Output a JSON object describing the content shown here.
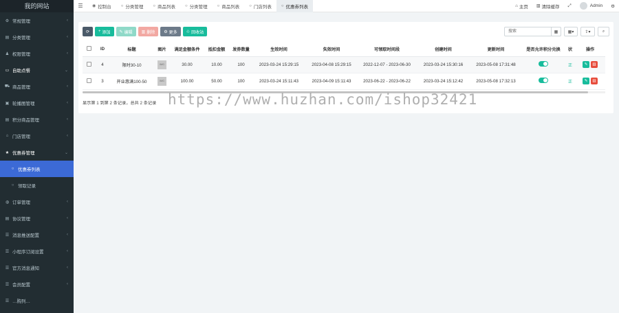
{
  "sidebar": {
    "logo": "我的网站",
    "items": [
      {
        "label": "常规管理",
        "icon": "gear-icon",
        "glyph": "⚙",
        "chevron": "‹"
      },
      {
        "label": "分类管理",
        "icon": "tag-icon",
        "glyph": "▤",
        "chevron": "‹"
      },
      {
        "label": "权限管理",
        "icon": "users-icon",
        "glyph": "♟",
        "chevron": "‹"
      },
      {
        "label": "自助点餐",
        "icon": "card-icon",
        "glyph": "▭",
        "chevron": "⌄"
      },
      {
        "label": "商品管理",
        "icon": "cart-icon",
        "glyph": "⛟",
        "chevron": "‹"
      },
      {
        "label": "轮播图管理",
        "icon": "image-icon",
        "glyph": "▣",
        "chevron": "‹"
      },
      {
        "label": "积分商品管理",
        "icon": "gift-icon",
        "glyph": "▤",
        "chevron": "‹"
      },
      {
        "label": "门店管理",
        "icon": "store-icon",
        "glyph": "⌂",
        "chevron": "‹"
      },
      {
        "label": "优惠券管理",
        "icon": "star-icon",
        "glyph": "★",
        "chevron": "⌄"
      },
      {
        "label": "优惠券列表",
        "icon": "circle-icon",
        "glyph": "○",
        "chevron": ""
      },
      {
        "label": "领取记录",
        "icon": "circle-icon",
        "glyph": "○",
        "chevron": ""
      },
      {
        "label": "订单管理",
        "icon": "globe-icon",
        "glyph": "◍",
        "chevron": "‹"
      },
      {
        "label": "协议管理",
        "icon": "doc-icon",
        "glyph": "▤",
        "chevron": "‹"
      },
      {
        "label": "消息推送配置",
        "icon": "list-icon",
        "glyph": "☰",
        "chevron": "‹"
      },
      {
        "label": "小程序订阅设置",
        "icon": "list-icon",
        "glyph": "☰",
        "chevron": "‹"
      },
      {
        "label": "官方消息通知",
        "icon": "list-icon",
        "glyph": "☰",
        "chevron": "‹"
      },
      {
        "label": "会员配置",
        "icon": "list-icon",
        "glyph": "☰",
        "chevron": "‹"
      },
      {
        "label": "…购列…",
        "icon": "list-icon",
        "glyph": "☰",
        "chevron": ""
      }
    ]
  },
  "topbar": {
    "tabs": [
      {
        "label": "控制台",
        "glyph": "◉"
      },
      {
        "label": "分类管理",
        "glyph": "○"
      },
      {
        "label": "商品列表",
        "glyph": "○"
      },
      {
        "label": "分类管理",
        "glyph": "○"
      },
      {
        "label": "商品列表",
        "glyph": "○"
      },
      {
        "label": "门店列表",
        "glyph": "○"
      },
      {
        "label": "优惠券列表",
        "glyph": "○"
      }
    ],
    "home_label": "主页",
    "clear_cache_label": "清除缓存",
    "user_name": "Admin"
  },
  "toolbar": {
    "add_label": "添加",
    "edit_label": "编辑",
    "delete_label": "删除",
    "more_label": "更多",
    "recycle_label": "回收站",
    "search_placeholder": "搜索"
  },
  "table": {
    "headers": [
      "",
      "ID",
      "标题",
      "图片",
      "满足金额条件",
      "抵扣金额",
      "发券数量",
      "生效时间",
      "失效时间",
      "可领取时间段",
      "创建时间",
      "更新时间",
      "是否允许积分兑换",
      "状",
      "操作"
    ],
    "rows": [
      {
        "id": "4",
        "title": "限时30-10",
        "image_text": "IMG",
        "threshold": "30.00",
        "discount": "10.00",
        "quantity": "100",
        "start_time": "2023-03-24 15:29:15",
        "end_time": "2023-04-08 15:29:15",
        "claim_period": "2022-12-07 - 2023-06-30",
        "created_at": "2023-03-24 15:30:16",
        "updated_at": "2023-05-08 17:31:48",
        "allow_points": true,
        "status": "正"
      },
      {
        "id": "3",
        "title": "开业惠满100-50",
        "image_text": "IMG",
        "threshold": "100.00",
        "discount": "50.00",
        "quantity": "100",
        "start_time": "2023-03-24 15:11:43",
        "end_time": "2023-04-09 15:11:43",
        "claim_period": "2023-06-22 - 2023-06-22",
        "created_at": "2023-03-24 15:12:42",
        "updated_at": "2023-05-08 17:32:13",
        "allow_points": true,
        "status": "正"
      }
    ]
  },
  "footer": {
    "summary": "显示第 1 到第 2 条记录，总共 2 条记录"
  },
  "watermark": "https://www.huzhan.com/ishop32421",
  "colors": {
    "sidebar_bg": "#222d32",
    "active_blue": "#3c6ad6",
    "accent_green": "#18bc9c",
    "danger_red": "#e74c3c"
  }
}
